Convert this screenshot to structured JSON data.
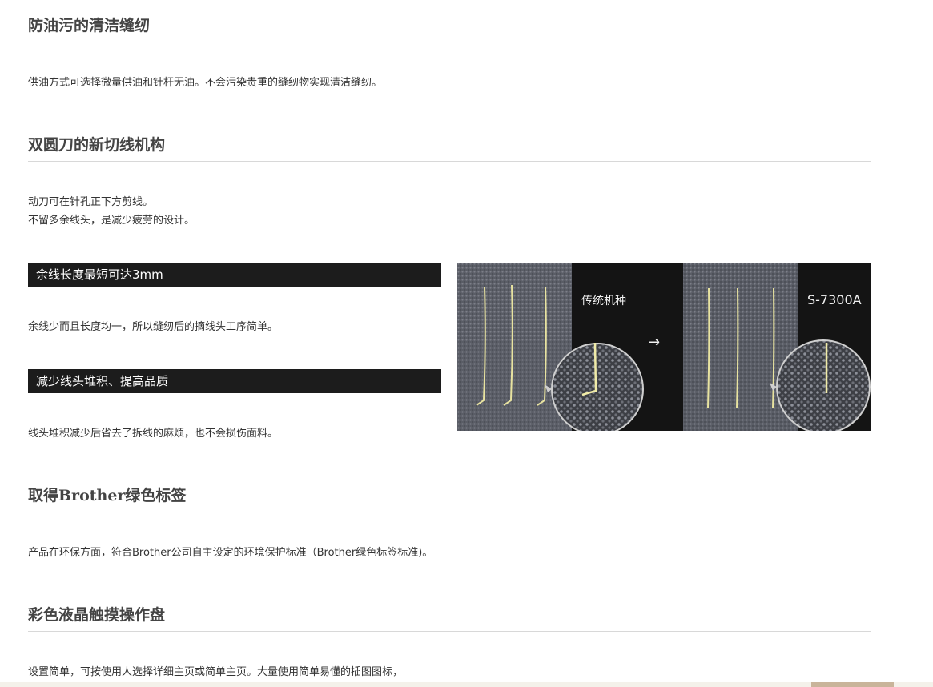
{
  "sections": [
    {
      "title": "防油污的清洁缝纫",
      "paragraphs": [
        "供油方式可选择微量供油和针杆无油。不会污染贵重的缝纫物实现清洁缝纫。"
      ]
    },
    {
      "title": "双圆刀的新切线机构",
      "paragraphs": [
        "动刀可在针孔正下方剪线。",
        "不留多余线头，是减少疲劳的设计。"
      ]
    },
    {
      "title": "取得Brother绿色标签",
      "paragraphs": [
        "产品在环保方面，符合Brother公司自主设定的环境保护标准（Brother绿色标签标准)。"
      ]
    },
    {
      "title": "彩色液晶触摸操作盘",
      "paragraphs": [
        "设置简单，可按使用人选择详细主页或简单主页。大量使用简单易懂的插图图标，"
      ]
    }
  ],
  "features": [
    {
      "heading": "余线长度最短可达3mm",
      "text": "余线少而且长度均一，所以缝纫后的摘线头工序简单。"
    },
    {
      "heading": "减少线头堆积、提高品质",
      "text": "线头堆积减少后省去了拆线的麻烦，也不会损伤面料。"
    }
  ],
  "figure": {
    "left_label": "传统机种",
    "arrow": "→",
    "right_label": "S-7300A"
  }
}
